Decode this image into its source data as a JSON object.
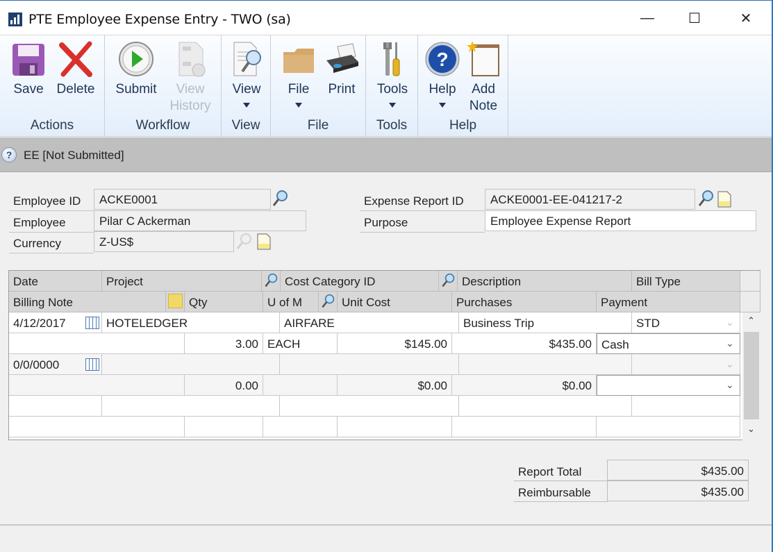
{
  "window": {
    "title": "PTE Employee Expense Entry  -  TWO (sa)",
    "controls": {
      "minimize": "—",
      "maximize": "☐",
      "close": "✕"
    }
  },
  "ribbon": {
    "groups": [
      {
        "label": "Actions",
        "buttons": [
          {
            "label": "Save",
            "icon": "save-icon"
          },
          {
            "label": "Delete",
            "icon": "delete-icon"
          }
        ]
      },
      {
        "label": "Workflow",
        "buttons": [
          {
            "label": "Submit",
            "icon": "submit-icon"
          },
          {
            "label": "View History",
            "icon": "view-history-icon",
            "disabled": true
          }
        ]
      },
      {
        "label": "View",
        "buttons": [
          {
            "label": "View",
            "icon": "view-icon",
            "dropdown": true
          }
        ]
      },
      {
        "label": "File",
        "buttons": [
          {
            "label": "File",
            "icon": "folder-icon",
            "dropdown": true
          },
          {
            "label": "Print",
            "icon": "printer-icon"
          }
        ]
      },
      {
        "label": "Tools",
        "buttons": [
          {
            "label": "Tools",
            "icon": "tools-icon",
            "dropdown": true
          }
        ]
      },
      {
        "label": "Help",
        "buttons": [
          {
            "label": "Help",
            "icon": "help-icon",
            "dropdown": true
          },
          {
            "label": "Add Note",
            "icon": "add-note-icon"
          }
        ]
      }
    ]
  },
  "status": {
    "text": "EE [Not Submitted]"
  },
  "form": {
    "employee_id": {
      "label": "Employee ID",
      "value": "ACKE0001"
    },
    "employee": {
      "label": "Employee",
      "value": "Pilar C Ackerman"
    },
    "currency": {
      "label": "Currency",
      "value": "Z-US$"
    },
    "expense_report_id": {
      "label": "Expense Report ID",
      "value": "ACKE0001-EE-041217-2"
    },
    "purpose": {
      "label": "Purpose",
      "value": "Employee Expense Report"
    }
  },
  "grid": {
    "headers_row1": {
      "date": "Date",
      "project": "Project",
      "cost_category": "Cost Category ID",
      "description": "Description",
      "bill_type": "Bill Type"
    },
    "headers_row2": {
      "billing_note": "Billing Note",
      "qty": "Qty",
      "uofm": "U of M",
      "unit_cost": "Unit Cost",
      "purchases": "Purchases",
      "payment": "Payment"
    },
    "rows": [
      {
        "date": "4/12/2017",
        "project": "HOTELEDGER",
        "cost_category": "AIRFARE",
        "description": "Business Trip",
        "bill_type": "STD",
        "billing_note": "",
        "qty": "3.00",
        "uofm": "EACH",
        "unit_cost": "$145.00",
        "purchases": "$435.00",
        "payment": "Cash"
      },
      {
        "date": "0/0/0000",
        "project": "",
        "cost_category": "",
        "description": "",
        "bill_type": "",
        "billing_note": "",
        "qty": "0.00",
        "uofm": "",
        "unit_cost": "$0.00",
        "purchases": "$0.00",
        "payment": ""
      }
    ]
  },
  "totals": {
    "report_total": {
      "label": "Report Total",
      "value": "$435.00"
    },
    "reimbursable": {
      "label": "Reimbursable",
      "value": "$435.00"
    }
  }
}
